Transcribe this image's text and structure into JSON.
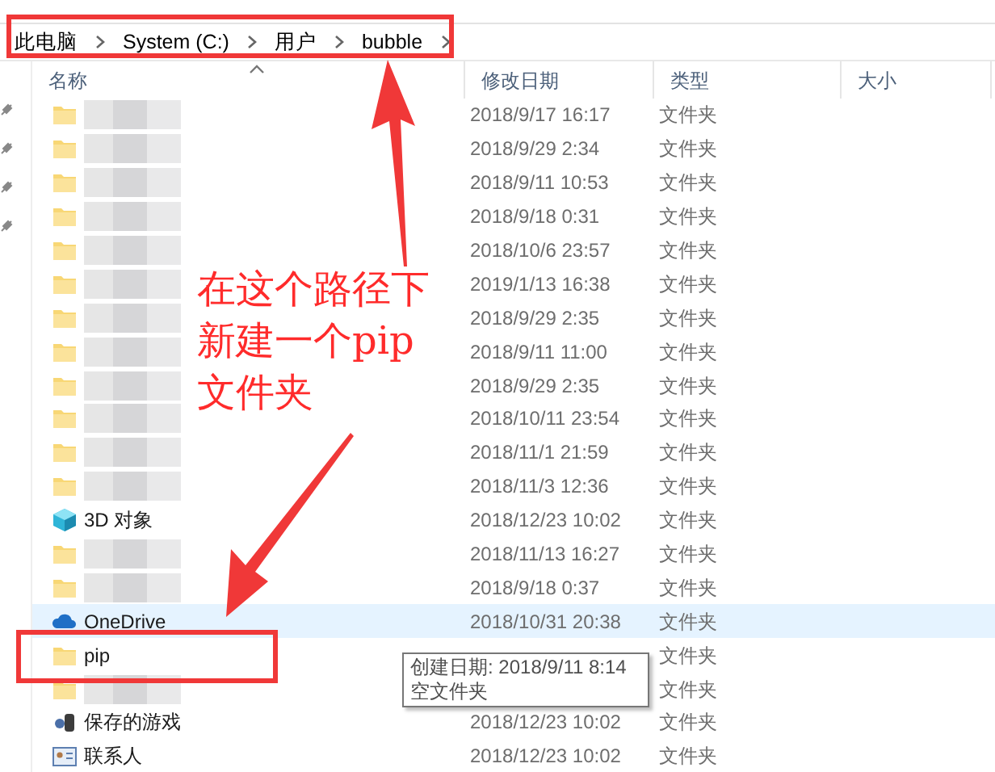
{
  "breadcrumb": [
    {
      "label": "此电脑"
    },
    {
      "label": "System (C:)"
    },
    {
      "label": "用户"
    },
    {
      "label": "bubble"
    }
  ],
  "columns": [
    {
      "label": "名称",
      "sorted": true
    },
    {
      "label": "修改日期",
      "sorted": false
    },
    {
      "label": "类型",
      "sorted": false
    },
    {
      "label": "大小",
      "sorted": false
    }
  ],
  "rows": [
    {
      "kind": "folder",
      "blurred": true,
      "modified": "2018/9/17 16:17",
      "type": "文件夹",
      "hovered": false,
      "outlined": false
    },
    {
      "kind": "folder",
      "blurred": true,
      "modified": "2018/9/29 2:34",
      "type": "文件夹",
      "hovered": false,
      "outlined": false
    },
    {
      "kind": "folder",
      "blurred": true,
      "modified": "2018/9/11 10:53",
      "type": "文件夹",
      "hovered": false,
      "outlined": false
    },
    {
      "kind": "folder",
      "blurred": true,
      "modified": "2018/9/18 0:31",
      "type": "文件夹",
      "hovered": false,
      "outlined": false
    },
    {
      "kind": "folder",
      "blurred": true,
      "modified": "2018/10/6 23:57",
      "type": "文件夹",
      "hovered": false,
      "outlined": false
    },
    {
      "kind": "folder",
      "blurred": true,
      "modified": "2019/1/13 16:38",
      "type": "文件夹",
      "hovered": false,
      "outlined": false
    },
    {
      "kind": "folder",
      "blurred": true,
      "modified": "2018/9/29 2:35",
      "type": "文件夹",
      "hovered": false,
      "outlined": false
    },
    {
      "kind": "folder",
      "blurred": true,
      "modified": "2018/9/11 11:00",
      "type": "文件夹",
      "hovered": false,
      "outlined": false
    },
    {
      "kind": "folder",
      "blurred": true,
      "modified": "2018/9/29 2:35",
      "type": "文件夹",
      "hovered": false,
      "outlined": false
    },
    {
      "kind": "folder",
      "blurred": true,
      "modified": "2018/10/11 23:54",
      "type": "文件夹",
      "hovered": false,
      "outlined": false
    },
    {
      "kind": "folder",
      "blurred": true,
      "modified": "2018/11/1 21:59",
      "type": "文件夹",
      "hovered": false,
      "outlined": false
    },
    {
      "kind": "folder",
      "blurred": true,
      "modified": "2018/11/3 12:36",
      "type": "文件夹",
      "hovered": false,
      "outlined": false
    },
    {
      "kind": "objects3d",
      "name": "3D 对象",
      "modified": "2018/12/23 10:02",
      "type": "文件夹",
      "hovered": false,
      "outlined": false
    },
    {
      "kind": "folder",
      "blurred": true,
      "modified": "2018/11/13 16:27",
      "type": "文件夹",
      "hovered": false,
      "outlined": false
    },
    {
      "kind": "folder",
      "blurred": true,
      "modified": "2018/9/18 0:37",
      "type": "文件夹",
      "hovered": false,
      "outlined": false
    },
    {
      "kind": "cloud",
      "name": "OneDrive",
      "modified": "2018/10/31 20:38",
      "type": "文件夹",
      "hovered": true,
      "outlined": false
    },
    {
      "kind": "folder",
      "name": "pip",
      "type": "文件夹",
      "hovered": false,
      "outlined": true
    },
    {
      "kind": "folder",
      "blurred": true,
      "type": "文件夹",
      "hovered": false,
      "outlined": false
    },
    {
      "kind": "games",
      "name": "保存的游戏",
      "modified": "2018/12/23 10:02",
      "type": "文件夹",
      "hovered": false,
      "outlined": false
    },
    {
      "kind": "contacts",
      "name": "联系人",
      "modified": "2018/12/23 10:02",
      "type": "文件夹",
      "hovered": false,
      "outlined": false
    }
  ],
  "tooltip": {
    "lines": [
      "创建日期: 2018/9/11 8:14",
      "空文件夹"
    ]
  },
  "annotation": {
    "lines": [
      "在这个路径下",
      "新建一个pip",
      "文件夹"
    ],
    "breadcrumb_outlined": true
  }
}
